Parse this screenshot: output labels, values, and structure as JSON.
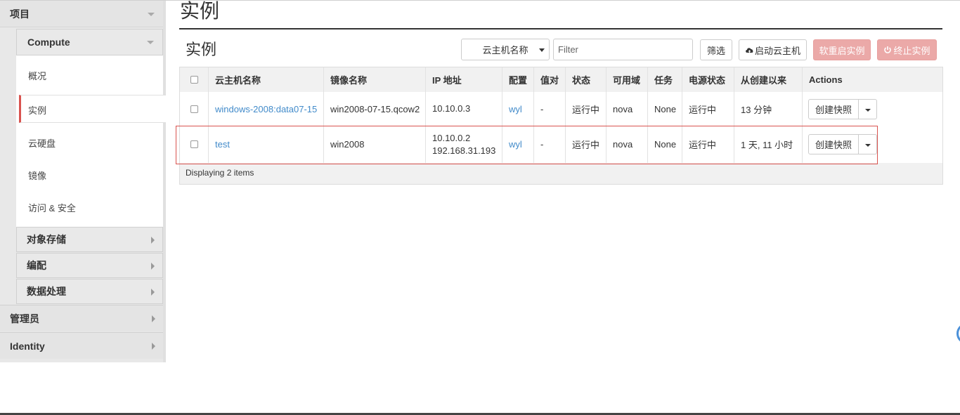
{
  "sidebar": {
    "project": "项目",
    "compute": "Compute",
    "items": [
      {
        "label": "概况"
      },
      {
        "label": "实例"
      },
      {
        "label": "云硬盘"
      },
      {
        "label": "镜像"
      },
      {
        "label": "访问 & 安全"
      }
    ],
    "subsections": [
      {
        "label": "对象存储"
      },
      {
        "label": "编配"
      },
      {
        "label": "数据处理"
      }
    ],
    "top_sections": [
      {
        "label": "管理员"
      },
      {
        "label": "Identity"
      }
    ]
  },
  "page": {
    "title": "实例",
    "table_title": "实例"
  },
  "toolbar": {
    "filter_field": "云主机名称",
    "filter_placeholder": "Filter",
    "filter_button": "筛选",
    "launch_button": "启动云主机",
    "soft_reboot_button": "软重启实例",
    "terminate_button": "终止实例"
  },
  "table": {
    "headers": [
      "云主机名称",
      "镜像名称",
      "IP 地址",
      "配置",
      "值对",
      "状态",
      "可用域",
      "任务",
      "电源状态",
      "从创建以来",
      "Actions"
    ],
    "rows": [
      {
        "name": "windows-2008:data07-15",
        "image": "win2008-07-15.qcow2",
        "ip": [
          "10.10.0.3"
        ],
        "flavor": "wyl",
        "keypair": "-",
        "status": "运行中",
        "zone": "nova",
        "task": "None",
        "power": "运行中",
        "age": "13 分钟",
        "action": "创建快照"
      },
      {
        "name": "test",
        "image": "win2008",
        "ip": [
          "10.10.0.2",
          "192.168.31.193"
        ],
        "flavor": "wyl",
        "keypair": "-",
        "status": "运行中",
        "zone": "nova",
        "task": "None",
        "power": "运行中",
        "age": "1 天, 11 小时",
        "action": "创建快照"
      }
    ],
    "footer": "Displaying 2 items"
  },
  "colors": {
    "link": "#428bca",
    "danger": "#d9534f",
    "danger_disabled": "#eba9a8"
  }
}
